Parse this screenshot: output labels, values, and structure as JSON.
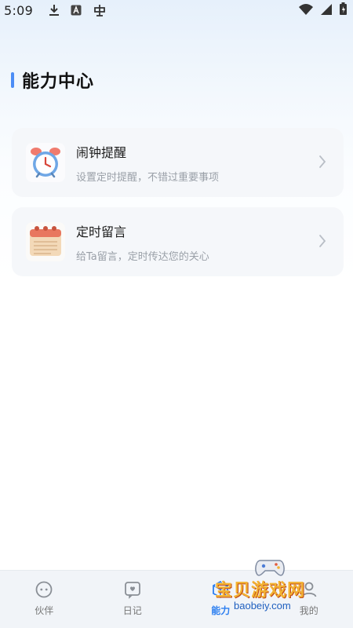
{
  "status_bar": {
    "time": "5:09"
  },
  "page": {
    "title": "能力中心"
  },
  "cards": [
    {
      "title": "闹钟提醒",
      "description": "设置定时提醒，不错过重要事项",
      "icon": "alarm-clock-icon"
    },
    {
      "title": "定时留言",
      "description": "给Ta留言，定时传达您的关心",
      "icon": "calendar-icon"
    }
  ],
  "bottom_nav": {
    "items": [
      {
        "label": "伙伴",
        "icon": "partner-icon",
        "active": false
      },
      {
        "label": "日记",
        "icon": "diary-icon",
        "active": false
      },
      {
        "label": "能力",
        "icon": "ability-icon",
        "active": true
      },
      {
        "label": "我的",
        "icon": "profile-icon",
        "active": false
      }
    ]
  },
  "watermark": {
    "text": "宝贝游戏网",
    "url": "baobeiy.com"
  },
  "colors": {
    "accent": "#4c8df6",
    "active_tab": "#2d7ff0",
    "card_bg": "#f5f7fa"
  }
}
